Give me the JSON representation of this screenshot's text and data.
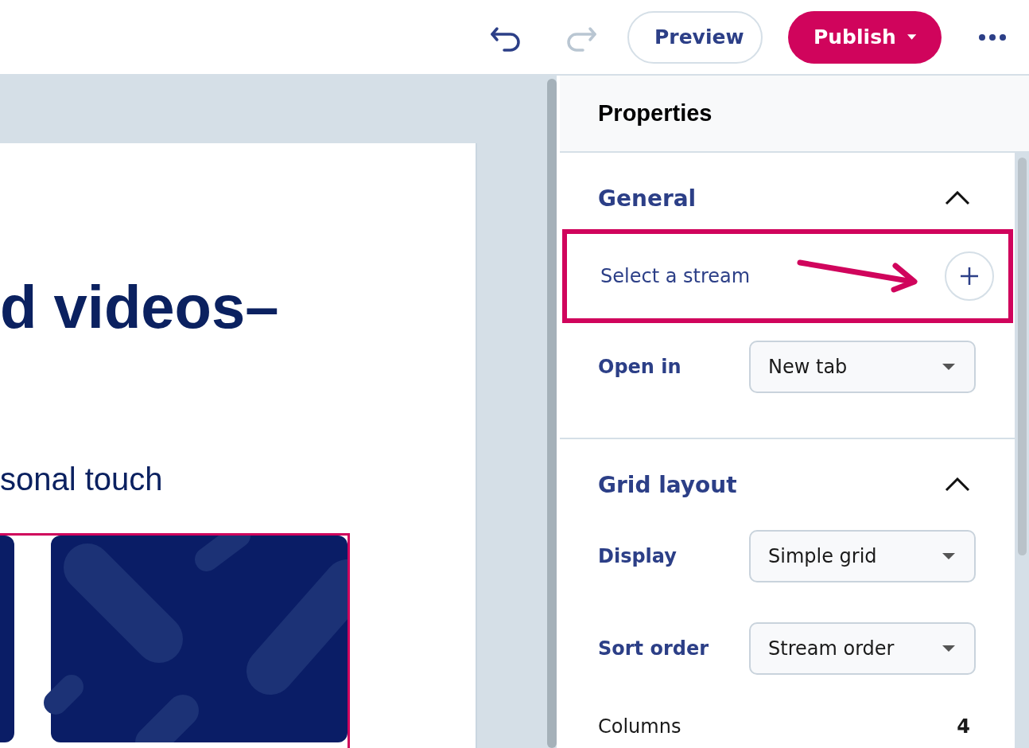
{
  "toolbar": {
    "undo": {
      "disabled": false
    },
    "redo": {
      "disabled": true
    },
    "buttons": [
      {
        "label": "Preview",
        "kind": "secondary"
      },
      {
        "label": "Publish",
        "kind": "primary"
      }
    ]
  },
  "canvas": {
    "heading": "d videos–",
    "subheading": "sonal touch",
    "tiles": {
      "selected": true
    }
  },
  "properties": {
    "title": "Properties",
    "sections": [
      {
        "title": "General",
        "expanded": true,
        "rows": [
          {
            "kind": "picker",
            "label": "Select a stream",
            "highlighted": true
          },
          {
            "kind": "dropdown",
            "label": "Open in",
            "value": "New tab"
          }
        ]
      },
      {
        "title": "Grid layout",
        "expanded": true,
        "rows": [
          {
            "kind": "dropdown",
            "label": "Display",
            "value": "Simple grid"
          },
          {
            "kind": "dropdown",
            "label": "Sort order",
            "value": "Stream order"
          },
          {
            "kind": "value",
            "label": "Columns",
            "value": "4"
          }
        ]
      }
    ]
  }
}
